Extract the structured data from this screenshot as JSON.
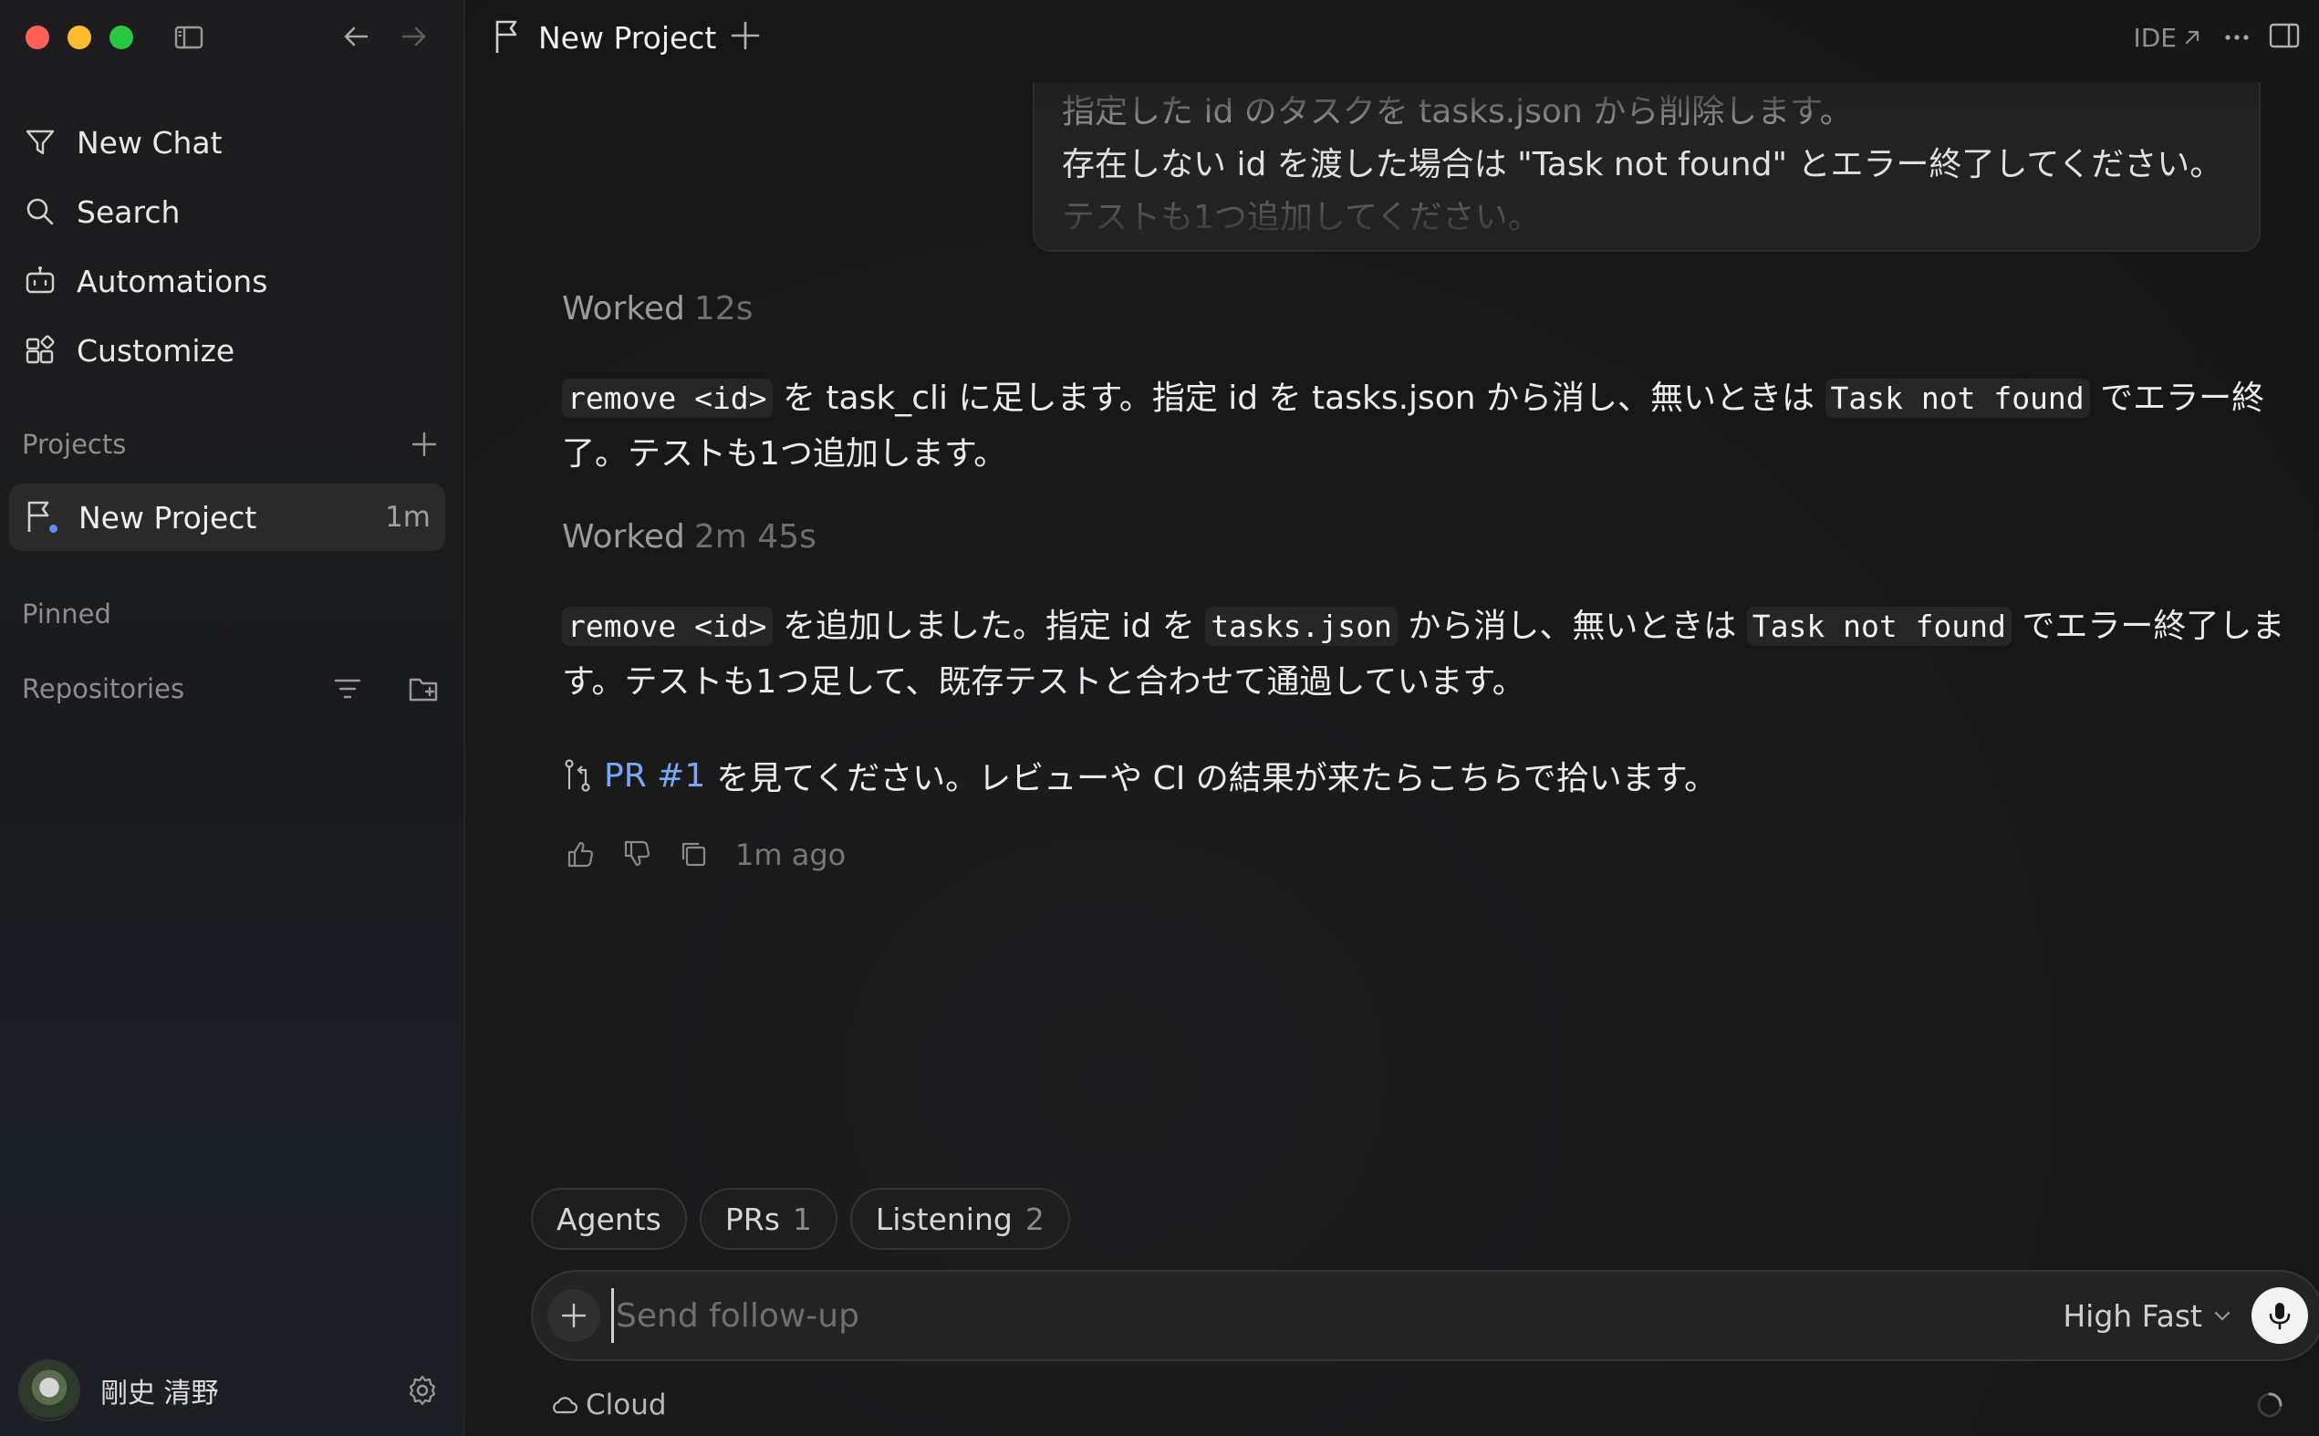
{
  "sidebar": {
    "nav": [
      {
        "label": "New Chat",
        "icon": "new-chat-icon"
      },
      {
        "label": "Search",
        "icon": "search-icon"
      },
      {
        "label": "Automations",
        "icon": "automations-icon"
      },
      {
        "label": "Customize",
        "icon": "customize-icon"
      }
    ],
    "projects_label": "Projects",
    "project": {
      "name": "New Project",
      "time": "1m",
      "status_color": "#5b8ff9"
    },
    "pinned_label": "Pinned",
    "repositories_label": "Repositories",
    "user_name": "剛史 清野"
  },
  "topbar": {
    "title": "New Project",
    "ide_label": "IDE"
  },
  "quoted": {
    "line1": "指定した id のタスクを tasks.json から削除します。",
    "line2": "存在しない id を渡した場合は \"Task not found\" とエラー終了してください。",
    "line3": "テストも1つ追加してください。"
  },
  "messages": {
    "m1": {
      "worked_label": "Worked",
      "duration": "12s",
      "code1": "remove <id>",
      "t1": " を task_cli に足します。指定 id を tasks.json から消し、無いときは ",
      "code2": "Task not found",
      "t2": " でエラー終了。テストも1つ追加します。"
    },
    "m2": {
      "worked_label": "Worked",
      "duration": "2m 45s",
      "code1": "remove <id>",
      "t1": " を追加しました。指定 id を ",
      "code2": "tasks.json",
      "t2": " から消し、無いときは ",
      "code3": "Task not found",
      "t3": " でエラー終了します。テストも1つ足して、既存テストと合わせて通過しています。"
    },
    "pr": {
      "link": "PR #1",
      "text": "を見てください。レビューや CI の結果が来たらこちらで拾います。"
    },
    "time_ago": "1m ago"
  },
  "chips": [
    {
      "label": "Agents",
      "count": ""
    },
    {
      "label": "PRs",
      "count": "1"
    },
    {
      "label": "Listening",
      "count": "2"
    }
  ],
  "composer": {
    "placeholder": "Send follow-up",
    "model_label": "High Fast"
  },
  "footer": {
    "cloud_label": "Cloud"
  },
  "colors": {
    "accent_link": "#7aa7f5",
    "traffic_red": "#fe5f57",
    "traffic_yellow": "#febc2e",
    "traffic_green": "#28c840"
  }
}
